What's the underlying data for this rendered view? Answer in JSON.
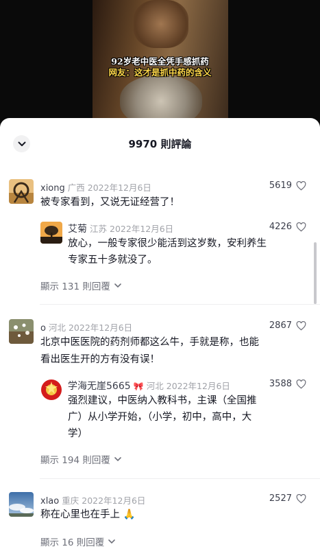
{
  "video": {
    "caption_line1": "92岁老中医全凭手感抓药",
    "caption_line2": "网友：这才是抓中药的含义"
  },
  "header": {
    "title": "9970 則評論"
  },
  "comments": [
    {
      "user": "xiong",
      "location": "广西",
      "date": "2022年12月6日",
      "likes": "5619",
      "text": "被专家看到，又说无证经营了！",
      "reply": {
        "user": "艾菊",
        "location": "江苏",
        "date": "2022年12月6日",
        "likes": "4226",
        "text_line1": "放心，一般专家很少能活到这岁数，安利养生",
        "text_line2": "专家五十多就没了。"
      },
      "more_replies": "顯示 131 則回覆"
    },
    {
      "user": "o",
      "location": "河北",
      "date": "2022年12月6日",
      "likes": "2867",
      "text_line1": "北京中医医院的药剂师都这么牛，手就是称，也能",
      "text_line2": "看出医生开的方有没有误！",
      "reply": {
        "user": "学海无崖5665",
        "badge": "🎀",
        "location": "河北",
        "date": "2022年12月6日",
        "likes": "3588",
        "text_line1": "强烈建议，中医纳入教科书，主课（全国推",
        "text_line2": "广）从小学开始，（小学，初中，高中，大",
        "text_line3": "学）"
      },
      "more_replies": "顯示 194 則回覆"
    },
    {
      "user": "xlao",
      "location": "重庆",
      "date": "2022年12月6日",
      "likes": "2527",
      "text": "称在心里也在手上 🙏",
      "more_replies": "顯示 16 則回覆"
    }
  ],
  "icons": {
    "collapse": "chevron-down-icon",
    "like": "heart-outline-icon",
    "expand": "chevron-down-small-icon"
  }
}
